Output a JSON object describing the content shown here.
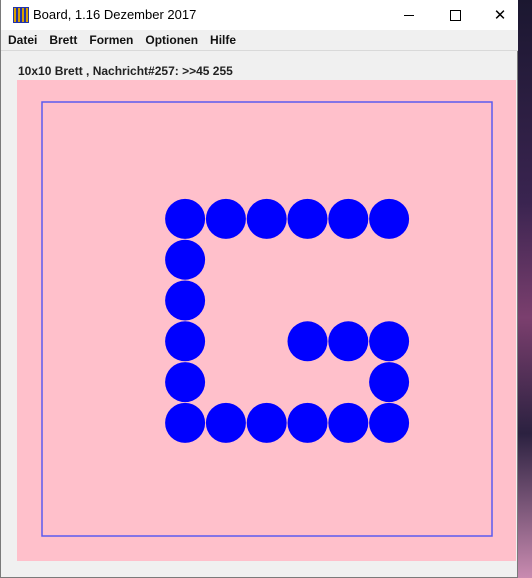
{
  "window": {
    "title": "Board, 1.16 Dezember 2017",
    "minimize_glyph": "",
    "close_glyph": "✕"
  },
  "menu": [
    "Datei",
    "Brett",
    "Formen",
    "Optionen",
    "Hilfe"
  ],
  "status_text": "10x10 Brett , Nachricht#257: >>45 255",
  "colors": {
    "board_background": "#ffc0cb",
    "frame_line": "#5a5af0",
    "piece": "#0000ff"
  },
  "icons": {
    "app": "board-app-icon",
    "minimize": "minimize-icon",
    "maximize": "maximize-icon",
    "close": "close-icon"
  },
  "board": {
    "size": 10,
    "pieces": [
      {
        "col": 3,
        "row": 3
      },
      {
        "col": 4,
        "row": 3
      },
      {
        "col": 5,
        "row": 3
      },
      {
        "col": 6,
        "row": 3
      },
      {
        "col": 7,
        "row": 3
      },
      {
        "col": 8,
        "row": 3
      },
      {
        "col": 3,
        "row": 4
      },
      {
        "col": 3,
        "row": 5
      },
      {
        "col": 3,
        "row": 6
      },
      {
        "col": 6,
        "row": 6
      },
      {
        "col": 7,
        "row": 6
      },
      {
        "col": 8,
        "row": 6
      },
      {
        "col": 3,
        "row": 7
      },
      {
        "col": 8,
        "row": 7
      },
      {
        "col": 3,
        "row": 8
      },
      {
        "col": 4,
        "row": 8
      },
      {
        "col": 5,
        "row": 8
      },
      {
        "col": 6,
        "row": 8
      },
      {
        "col": 7,
        "row": 8
      },
      {
        "col": 8,
        "row": 8
      }
    ]
  }
}
